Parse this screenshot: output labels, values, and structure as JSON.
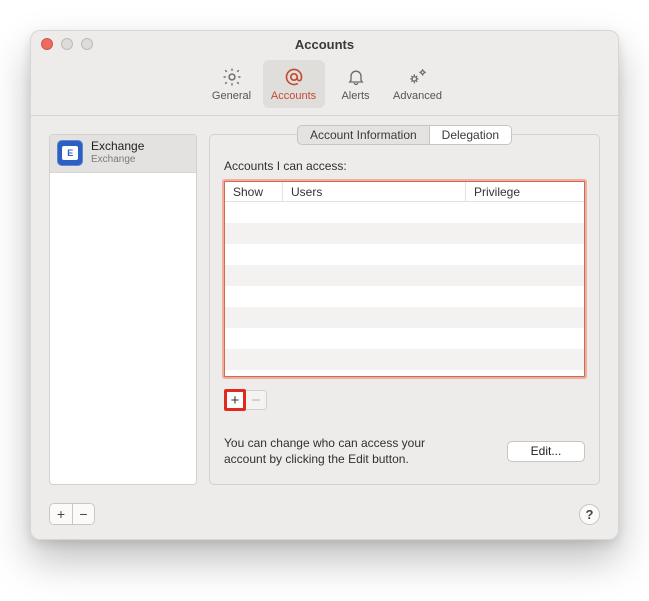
{
  "window": {
    "title": "Accounts"
  },
  "toolbar": {
    "items": [
      {
        "label": "General"
      },
      {
        "label": "Accounts"
      },
      {
        "label": "Alerts"
      },
      {
        "label": "Advanced"
      }
    ],
    "selected": "Accounts"
  },
  "sidebar": {
    "accounts": [
      {
        "name": "Exchange",
        "subtitle": "Exchange",
        "badge": "E"
      }
    ]
  },
  "tabs": {
    "items": [
      "Account Information",
      "Delegation"
    ],
    "active": "Delegation"
  },
  "delegation": {
    "access_label": "Accounts I can access:",
    "columns": {
      "show": "Show",
      "users": "Users",
      "privilege": "Privilege"
    },
    "rows": [],
    "hint": "You can change who can access your account by clicking the Edit button.",
    "edit_label": "Edit..."
  },
  "glyphs": {
    "plus": "+",
    "minus": "−",
    "help": "?"
  },
  "colors": {
    "accent_highlight": "#e02a1f",
    "selected_tab": "#c24b34",
    "exchange_blue": "#2b5fc1"
  }
}
